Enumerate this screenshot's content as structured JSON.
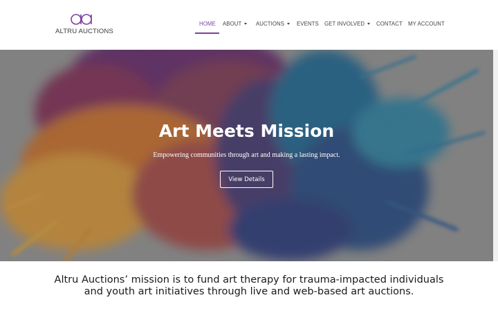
{
  "brand": {
    "name": "ALTRU AUCTIONS",
    "logo_mark": "aa-logo",
    "accent_color": "#7b3fa0"
  },
  "nav": {
    "items": [
      {
        "label": "HOME",
        "active": true,
        "has_dropdown": false
      },
      {
        "label": "ABOUT",
        "active": false,
        "has_dropdown": true
      },
      {
        "label": "AUCTIONS",
        "active": false,
        "has_dropdown": true
      },
      {
        "label": "EVENTS",
        "active": false,
        "has_dropdown": false
      },
      {
        "label": "GET INVOLVED",
        "active": false,
        "has_dropdown": true
      },
      {
        "label": "CONTACT",
        "active": false,
        "has_dropdown": false
      },
      {
        "label": "MY ACCOUNT",
        "active": false,
        "has_dropdown": false
      }
    ]
  },
  "hero": {
    "title": "Art Meets Mission",
    "subtitle": "Empowering communities through art and making a lasting impact.",
    "button_label": "View Details",
    "background": "watercolor-splash"
  },
  "mission": {
    "line1": "Altru Auctions’ mission is to fund art therapy for trauma-impacted individuals",
    "line2": "and youth art initiatives through live and web-based art auctions."
  }
}
